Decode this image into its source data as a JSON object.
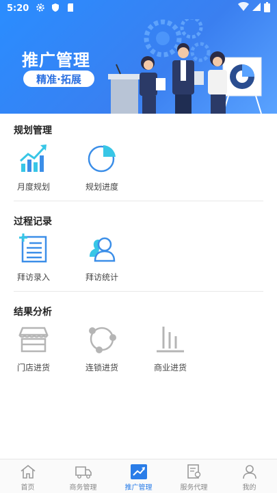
{
  "status_bar": {
    "time": "5:20"
  },
  "banner": {
    "title": "推广管理",
    "tagline": "精准·拓展"
  },
  "sections": [
    {
      "title": "规划管理",
      "items": [
        {
          "label": "月度规划",
          "icon": "trend-chart-icon"
        },
        {
          "label": "规划进度",
          "icon": "pie-chart-icon"
        }
      ]
    },
    {
      "title": "过程记录",
      "items": [
        {
          "label": "拜访录入",
          "icon": "add-list-icon"
        },
        {
          "label": "拜访统计",
          "icon": "people-icon"
        }
      ]
    },
    {
      "title": "结果分析",
      "items": [
        {
          "label": "门店进货",
          "icon": "store-icon"
        },
        {
          "label": "连锁进货",
          "icon": "chain-icon"
        },
        {
          "label": "商业进货",
          "icon": "bar-chart-icon"
        }
      ]
    }
  ],
  "bottom_nav": [
    {
      "label": "首页",
      "icon": "home-icon",
      "active": false
    },
    {
      "label": "商务管理",
      "icon": "truck-icon",
      "active": false
    },
    {
      "label": "推广管理",
      "icon": "trend-icon",
      "active": true
    },
    {
      "label": "服务代理",
      "icon": "certificate-icon",
      "active": false
    },
    {
      "label": "我的",
      "icon": "user-icon",
      "active": false
    }
  ],
  "colors": {
    "primary": "#2a7de8",
    "banner": "#2a8dff",
    "icon_blue": "#3b8ee8",
    "icon_cyan": "#38c6e6",
    "icon_gray": "#b5b5b5"
  }
}
